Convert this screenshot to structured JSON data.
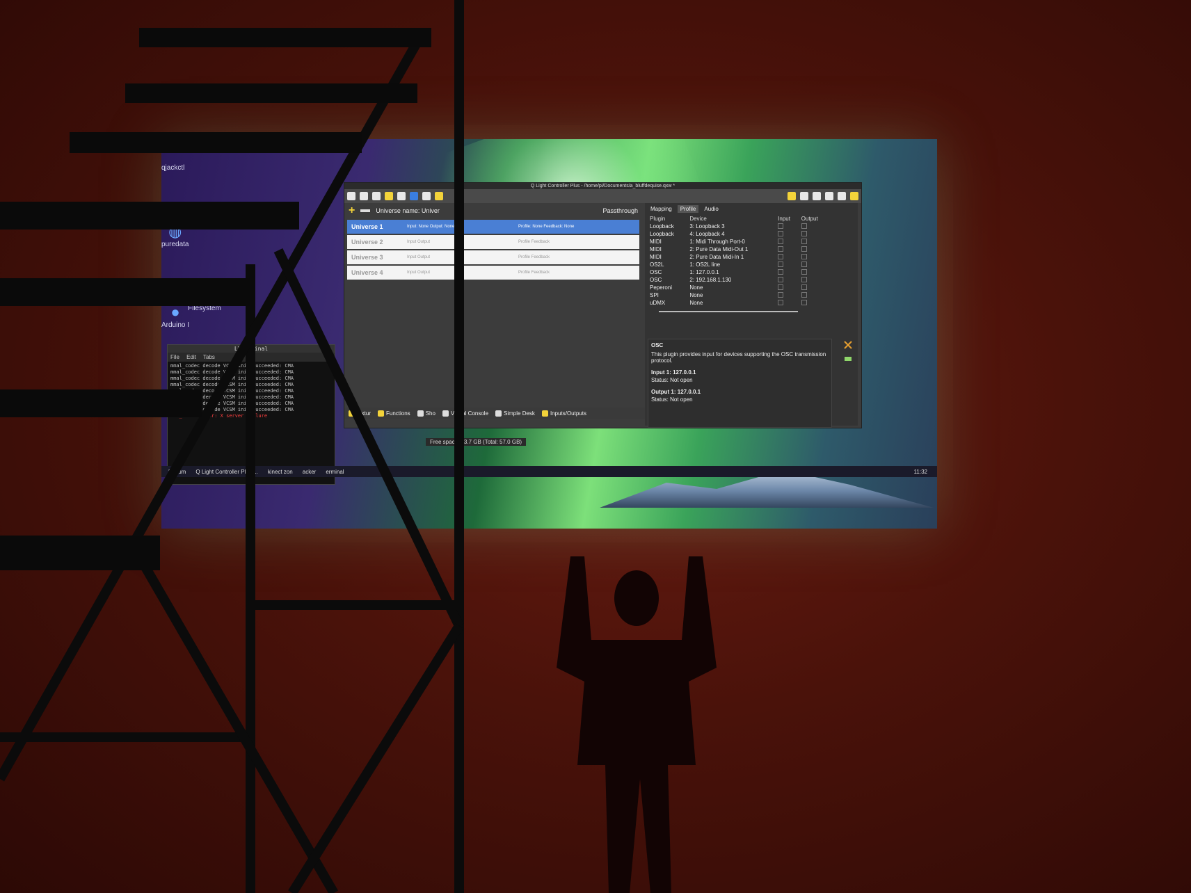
{
  "window_title": "Q Light Controller Plus - /home/pi/Documents/a_bluffdequise.qxw *",
  "desktop_icons": [
    "qjackctl",
    "puredata",
    "Arduino I",
    "Filesystem"
  ],
  "terminal": {
    "title": "LXTerminal",
    "menu": [
      "File",
      "Edit",
      "Tabs"
    ],
    "lines": [
      "mmal_codec decode VCSM init succeeded: CMA",
      "mmal_codec decode VCSM init succeeded: CMA",
      "mmal_codec decode VCSM init succeeded: CMA",
      "mmal_codec decode VCSM init succeeded: CMA",
      "mmal_codec decode VCSM init succeeded: CMA",
      "mmal_codec decode VCSM init succeeded: CMA",
      "mmal_codec decode VCSM init succeeded: CMA",
      "mmal_codec decode VCSM init succeeded: CMA"
    ],
    "error_line": "xcb_window_rror: X server failure"
  },
  "universe_panel": {
    "name_label": "Universe name: Univer",
    "passthrough_label": "Passthrough",
    "universes": [
      {
        "name": "Universe 1",
        "io": "Input: None  Output: None",
        "profile": "Profile: None  Feedback: None"
      },
      {
        "name": "Universe 2",
        "io": "Input  Output",
        "profile": "Profile  Feedback"
      },
      {
        "name": "Universe 3",
        "io": "Input  Output",
        "profile": "Profile  Feedback"
      },
      {
        "name": "Universe 4",
        "io": "Input  Output",
        "profile": "Profile  Feedback"
      }
    ]
  },
  "bottom_tabs": [
    "Fixtur",
    "Functions",
    "Sho",
    "Virtual Console",
    "Simple Desk",
    "Inputs/Outputs"
  ],
  "right_tabs": [
    "Mapping",
    "Profile",
    "Audio"
  ],
  "ports_table": {
    "headers": [
      "Plugin",
      "Device",
      "Input",
      "Output"
    ],
    "rows": [
      [
        "Loopback",
        "3: Loopback 3"
      ],
      [
        "Loopback",
        "4: Loopback 4"
      ],
      [
        "MIDI",
        "1: Midi Through Port-0"
      ],
      [
        "MIDI",
        "2: Pure Data Midi-Out 1"
      ],
      [
        "MIDI",
        "2: Pure Data Midi-In 1"
      ],
      [
        "OS2L",
        "1: OS2L line"
      ],
      [
        "OSC",
        "1: 127.0.0.1"
      ],
      [
        "OSC",
        "2: 192.168.1.130"
      ],
      [
        "Peperoni",
        "None"
      ],
      [
        "SPI",
        "None"
      ],
      [
        "uDMX",
        "None"
      ]
    ]
  },
  "info_panel": {
    "heading": "OSC",
    "description": "This plugin provides input for devices supporting the OSC transmission protocol.",
    "input_title": "Input 1: 127.0.0.1",
    "input_status": "Status: Not open",
    "output_title": "Output 1: 127.0.0.1",
    "output_status": "Status: Not open"
  },
  "status_bar": "Free space: 33.7 GB (Total: 57.0 GB)",
  "taskbar": {
    "items": [
      "Docum",
      "Q Light Controller Plus ...",
      "kinect zon",
      "acker",
      "erminal"
    ],
    "clock": "11:32"
  }
}
